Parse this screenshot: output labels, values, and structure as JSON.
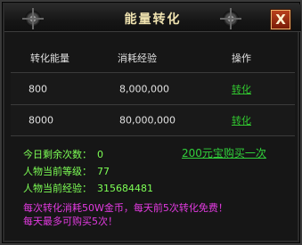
{
  "window": {
    "title": "能量转化",
    "close_label": "X"
  },
  "table": {
    "headers": [
      "转化能量",
      "消耗经验",
      "操作"
    ],
    "rows": [
      {
        "energy": "800",
        "exp": "8,000,000",
        "action": "转化"
      },
      {
        "energy": "8000",
        "exp": "80,000,000",
        "action": "转化"
      }
    ]
  },
  "info": {
    "remaining_label": "今日剩余次数：",
    "remaining_value": "0",
    "level_label": "人物当前等级：",
    "level_value": "77",
    "exp_label": "人物当前经验：",
    "exp_value": "315684481",
    "buy_link": "200元宝购买一次"
  },
  "notice": {
    "line1": "每次转化消耗50W金币，每天前5次转化免费！",
    "line2": "每天最多可购买5次！"
  }
}
